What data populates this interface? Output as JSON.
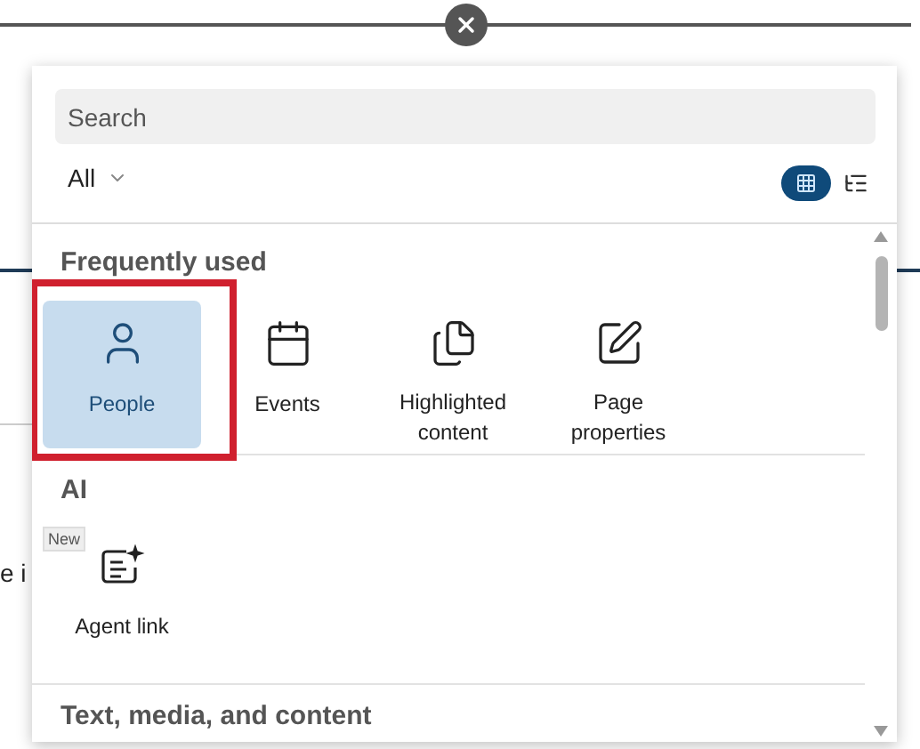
{
  "background_text": "e i",
  "search": {
    "placeholder": "Search"
  },
  "filter": {
    "label": "All"
  },
  "view_toggle": [
    {
      "selected": true
    },
    {
      "selected": false
    }
  ],
  "sections": [
    {
      "title": "Frequently used",
      "items": [
        {
          "label": "People",
          "selected": true,
          "highlighted": true
        },
        {
          "label": "Events",
          "selected": false,
          "highlighted": false
        },
        {
          "label": "Highlighted content",
          "selected": false,
          "highlighted": false
        },
        {
          "label": "Page properties",
          "selected": false,
          "highlighted": false
        }
      ]
    },
    {
      "title": "AI",
      "items": [
        {
          "label": "Agent link",
          "badge": "New",
          "selected": false,
          "highlighted": false
        }
      ]
    },
    {
      "title": "Text, media, and content"
    }
  ]
}
